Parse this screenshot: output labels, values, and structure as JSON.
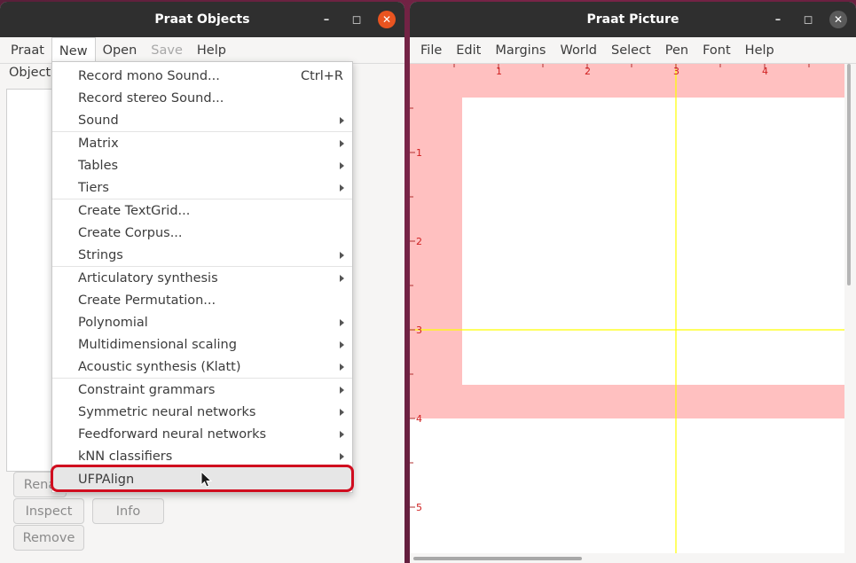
{
  "objects_window": {
    "title": "Praat Objects",
    "menu": [
      "Praat",
      "New",
      "Open",
      "Save",
      "Help"
    ],
    "objects_label": "Objects",
    "buttons": {
      "rename": "Rena",
      "inspect": "Inspect",
      "info": "Info",
      "remove": "Remove"
    }
  },
  "new_menu": {
    "items": [
      {
        "label": "Record mono Sound...",
        "shortcut": "Ctrl+R"
      },
      {
        "label": "Record stereo Sound..."
      },
      {
        "label": "Sound",
        "submenu": true
      },
      {
        "label": "Matrix",
        "submenu": true
      },
      {
        "label": "Tables",
        "submenu": true
      },
      {
        "label": "Tiers",
        "submenu": true
      },
      {
        "label": "Create TextGrid..."
      },
      {
        "label": "Create Corpus..."
      },
      {
        "label": "Strings",
        "submenu": true
      },
      {
        "label": "Articulatory synthesis",
        "submenu": true
      },
      {
        "label": "Create Permutation..."
      },
      {
        "label": "Polynomial",
        "submenu": true
      },
      {
        "label": "Multidimensional scaling",
        "submenu": true
      },
      {
        "label": "Acoustic synthesis (Klatt)",
        "submenu": true
      },
      {
        "label": "Constraint grammars",
        "submenu": true
      },
      {
        "label": "Symmetric neural networks",
        "submenu": true
      },
      {
        "label": "Feedforward neural networks",
        "submenu": true
      },
      {
        "label": "kNN classifiers",
        "submenu": true
      },
      {
        "label": "UFPAlign",
        "hovered": true
      }
    ]
  },
  "picture_window": {
    "title": "Praat Picture",
    "menu": [
      "File",
      "Edit",
      "Margins",
      "World",
      "Select",
      "Pen",
      "Font",
      "Help"
    ],
    "ruler_top": [
      "1",
      "2",
      "3",
      "4"
    ],
    "ruler_left": [
      "1",
      "2",
      "3",
      "4",
      "5"
    ]
  },
  "colors": {
    "accent_close": "#e95420",
    "highlight_ring": "#d00d1f",
    "selection_pink": "#ffc0c0",
    "crosshair": "#ffff00",
    "ruler_red": "#d02020"
  }
}
